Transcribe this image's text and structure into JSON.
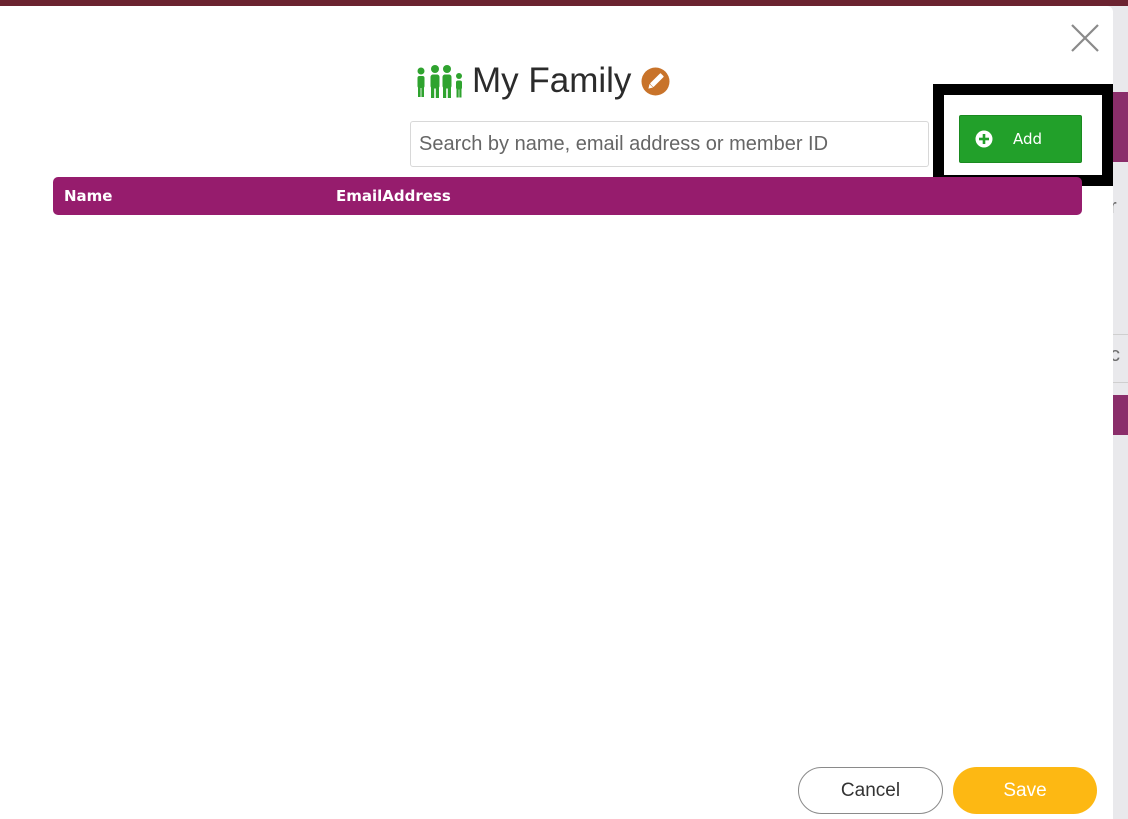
{
  "modal": {
    "title": "My Family",
    "icons": {
      "family": "family-icon",
      "edit": "pencil-edit-icon",
      "close": "close-icon",
      "add": "plus-circle-icon"
    },
    "search": {
      "placeholder": "Search by name, email address or member ID",
      "value": ""
    },
    "add_label": "Add",
    "table": {
      "columns": [
        "Name",
        "EmailAddress"
      ],
      "rows": []
    },
    "cancel_label": "Cancel",
    "save_label": "Save"
  },
  "background": {
    "partial_text_1": "r",
    "partial_text_2": "c"
  },
  "colors": {
    "accent_purple": "#961c6d",
    "add_green": "#22a02a",
    "save_yellow": "#fdb813",
    "icon_green": "#2fa32f",
    "edit_orange": "#c8732a",
    "highlight": "#000000"
  }
}
